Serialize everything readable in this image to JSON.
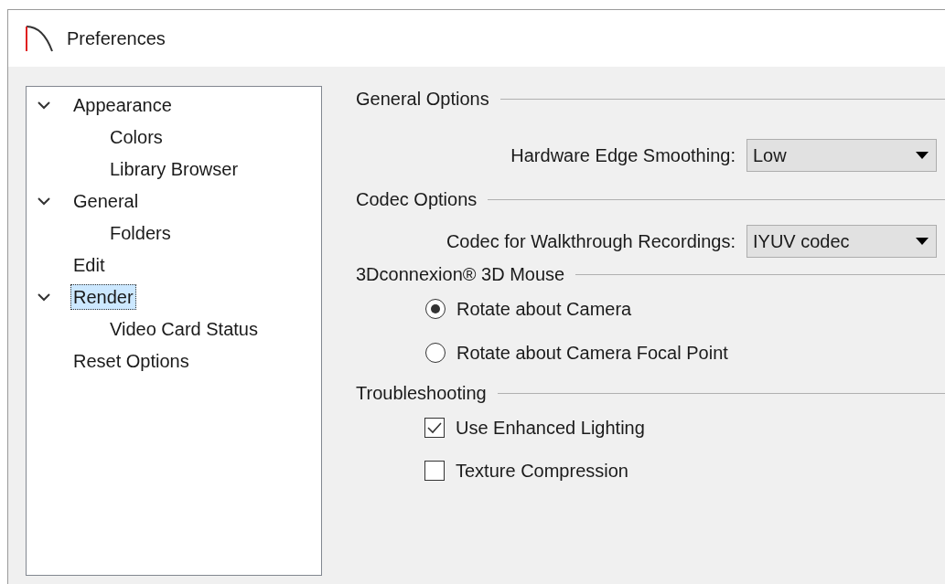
{
  "window": {
    "title": "Preferences"
  },
  "tree": [
    {
      "label": "Appearance",
      "expanded": true,
      "selected": false,
      "children": [
        {
          "label": "Colors",
          "selected": false
        },
        {
          "label": "Library Browser",
          "selected": false
        }
      ]
    },
    {
      "label": "General",
      "expanded": true,
      "selected": false,
      "children": [
        {
          "label": "Folders",
          "selected": false
        }
      ]
    },
    {
      "label": "Edit",
      "selected": false
    },
    {
      "label": "Render",
      "expanded": true,
      "selected": true,
      "children": [
        {
          "label": "Video Card Status",
          "selected": false
        }
      ]
    },
    {
      "label": "Reset Options",
      "selected": false
    }
  ],
  "sections": [
    {
      "title": "General Options",
      "items": [
        {
          "kind": "dropdown",
          "label": "Hardware Edge Smoothing:",
          "value": "Low"
        }
      ]
    },
    {
      "title": "Codec Options",
      "items": [
        {
          "kind": "dropdown",
          "label": "Codec for Walkthrough Recordings:",
          "value": "IYUV codec"
        }
      ]
    },
    {
      "title": "3Dconnexion® 3D Mouse",
      "items": [
        {
          "kind": "radio",
          "label": "Rotate about Camera",
          "selected": true
        },
        {
          "kind": "radio",
          "label": "Rotate about Camera Focal Point",
          "selected": false
        }
      ]
    },
    {
      "title": "Troubleshooting",
      "items": [
        {
          "kind": "checkbox",
          "label": "Use Enhanced Lighting",
          "checked": true
        },
        {
          "kind": "checkbox",
          "label": "Texture Compression",
          "checked": false
        }
      ]
    }
  ]
}
